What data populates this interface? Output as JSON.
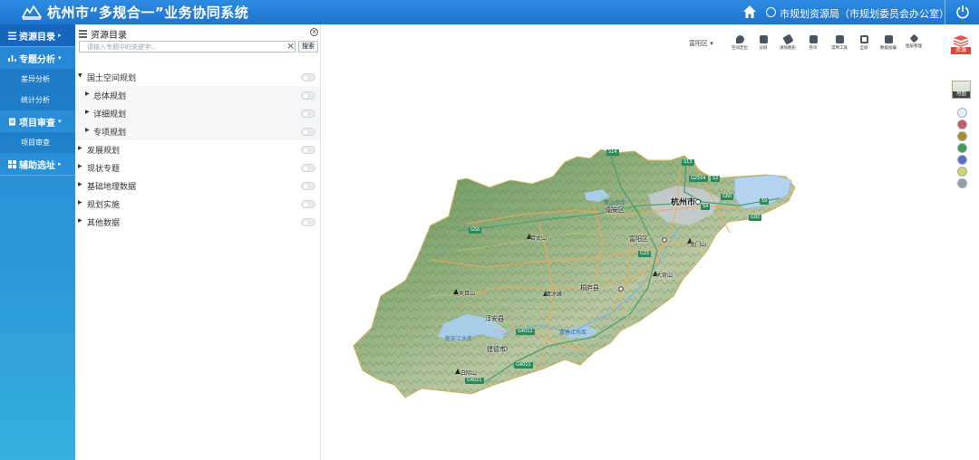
{
  "header": {
    "title": "杭州市“多规合一”业务协同系统",
    "user": "市规划资源局（市规划委员会办公室）"
  },
  "nav": {
    "items": [
      {
        "label": "资源目录",
        "caret": "▸"
      },
      {
        "label": "专题分析",
        "caret": "▾"
      },
      {
        "label": "项目审查",
        "caret": "▾"
      },
      {
        "label": "辅助选址",
        "caret": "▸"
      }
    ],
    "sub_analysis": [
      "差异分析",
      "统计分析"
    ],
    "sub_review": [
      "项目审查"
    ]
  },
  "panel": {
    "title": "资源目录",
    "search_placeholder": "请输入专题中的关键字...",
    "search_button": "搜索",
    "tree": [
      {
        "label": "国土空间规划",
        "arrow": "▼"
      },
      {
        "label": "总体规划",
        "arrow": "▶"
      },
      {
        "label": "详细规划",
        "arrow": "▶"
      },
      {
        "label": "专项规划",
        "arrow": "▶"
      },
      {
        "label": "发展规划",
        "arrow": "▶"
      },
      {
        "label": "现状专题",
        "arrow": "▶"
      },
      {
        "label": "基础地理数据",
        "arrow": "▶"
      },
      {
        "label": "规划实施",
        "arrow": "▶"
      },
      {
        "label": "其他数据",
        "arrow": "▶"
      }
    ]
  },
  "toolbar": {
    "district": "富阳区",
    "district_caret": "▾",
    "tools": [
      "空间定位",
      "分屏",
      "清除图形",
      "卷帘",
      "常用工具",
      "全屏",
      "数据加载",
      "图层管理"
    ]
  },
  "right_rail": {
    "resource_label": "资源",
    "basemap_label": "地图",
    "layer_dot_colors": [
      "#dff2fb",
      "#c05a64",
      "#a98f2a",
      "#3e9a58",
      "#5b6ec6",
      "#c9d86a",
      "#8d9ea4"
    ]
  },
  "map": {
    "places": [
      "杭州市",
      "富阳区",
      "临安区",
      "桐庐县",
      "淳安县",
      "建德市",
      "青山水库",
      "富春江水库",
      "新安江水库",
      "百丈山",
      "天目山",
      "清凉峰",
      "千岛湖",
      "龙门山",
      "大奇山",
      "白际山"
    ],
    "highways": [
      "S14",
      "S13",
      "G2504",
      "S2",
      "G60",
      "G92",
      "S9",
      "S4",
      "G56",
      "G25",
      "G4012",
      "G4011",
      "G4021"
    ],
    "reservoirs": [
      "青山水库",
      "新安江水库",
      "富春江水库"
    ]
  }
}
